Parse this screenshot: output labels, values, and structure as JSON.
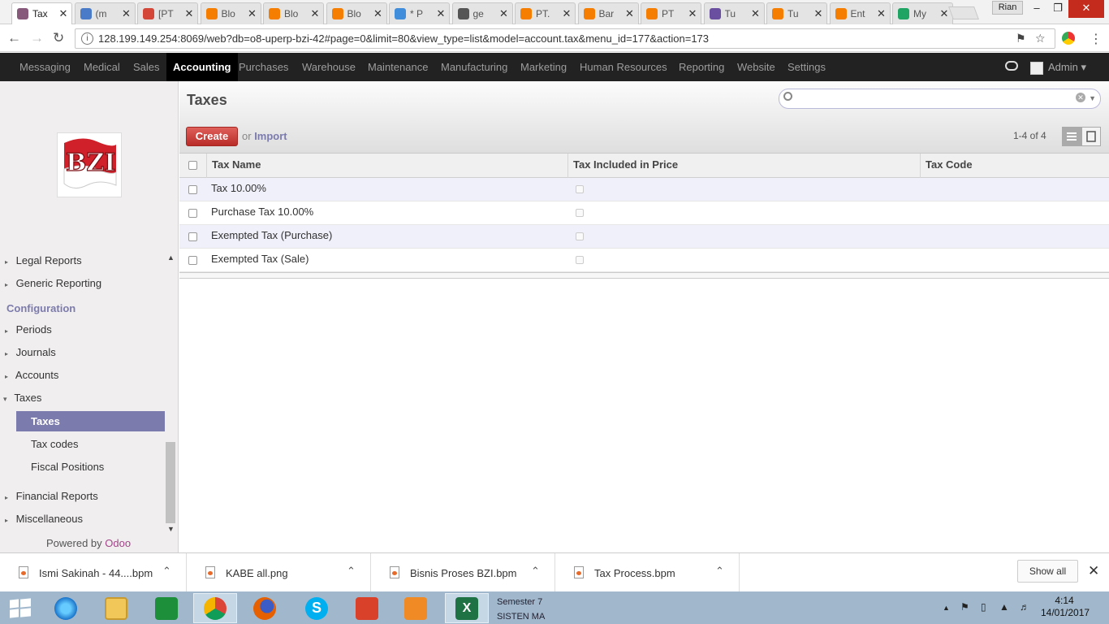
{
  "browser": {
    "tabs": [
      {
        "title": "Tax",
        "active": true,
        "color": "#875a7b"
      },
      {
        "title": "(m",
        "color": "#4a7bc8"
      },
      {
        "title": "[PT",
        "color": "#d44638"
      },
      {
        "title": "Blo",
        "color": "#f57d00"
      },
      {
        "title": "Blo",
        "color": "#f57d00"
      },
      {
        "title": "Blo",
        "color": "#f57d00"
      },
      {
        "title": "* P",
        "color": "#3f8ddb"
      },
      {
        "title": "ge",
        "color": "#555555"
      },
      {
        "title": "PT.",
        "color": "#f57d00"
      },
      {
        "title": "Bar",
        "color": "#f57d00"
      },
      {
        "title": "PT",
        "color": "#f57d00"
      },
      {
        "title": "Tu",
        "color": "#6a4fa0"
      },
      {
        "title": "Tu",
        "color": "#f57d00"
      },
      {
        "title": "Ent",
        "color": "#f57d00"
      },
      {
        "title": "My",
        "color": "#1fa463"
      }
    ],
    "user": "Rian",
    "url": "128.199.149.254:8069/web?db=o8-uperp-bzi-42#page=0&limit=80&view_type=list&model=account.tax&menu_id=177&action=173"
  },
  "topmenu": {
    "items": [
      "Messaging",
      "Medical",
      "Sales",
      "Accounting",
      "Purchases",
      "Warehouse",
      "Maintenance",
      "Manufacturing",
      "Marketing",
      "Human Resources",
      "Reporting",
      "Website",
      "Settings"
    ],
    "active": "Accounting",
    "user": "Admin"
  },
  "sidebar": {
    "logo_text": "BZI",
    "items_top": [
      "Legal Reports",
      "Generic Reporting"
    ],
    "config_header": "Configuration",
    "config_items": [
      "Periods",
      "Journals",
      "Accounts",
      "Taxes"
    ],
    "sub_selected": "Taxes",
    "sub_items": [
      "Tax codes",
      "Fiscal Positions"
    ],
    "items_bottom": [
      "Financial Reports",
      "Miscellaneous"
    ],
    "powered_by": "Powered by",
    "powered_brand": "Odoo"
  },
  "main": {
    "title": "Taxes",
    "search_placeholder": "",
    "create_label": "Create",
    "or_label": "or",
    "import_label": "Import",
    "pager": "1-4 of 4",
    "columns": [
      "Tax Name",
      "Tax Included in Price",
      "Tax Code"
    ],
    "rows": [
      {
        "name": "Tax 10.00%",
        "included": false,
        "code": ""
      },
      {
        "name": "Purchase Tax 10.00%",
        "included": false,
        "code": ""
      },
      {
        "name": "Exempted Tax (Purchase)",
        "included": false,
        "code": ""
      },
      {
        "name": "Exempted Tax (Sale)",
        "included": false,
        "code": ""
      }
    ]
  },
  "downloads": {
    "files": [
      "Ismi Sakinah - 44....bpm",
      "KABE all.png",
      "Bisnis Proses BZI.bpm",
      "Tax Process.bpm"
    ],
    "show_all": "Show all"
  },
  "taskbar": {
    "stack": [
      "Semester 7",
      "SISTEN MA"
    ],
    "time": "4:14",
    "date": "14/01/2017"
  },
  "colors": {
    "accent": "#7c7bad",
    "create": "#dc5f59",
    "menubar": "#222222"
  }
}
